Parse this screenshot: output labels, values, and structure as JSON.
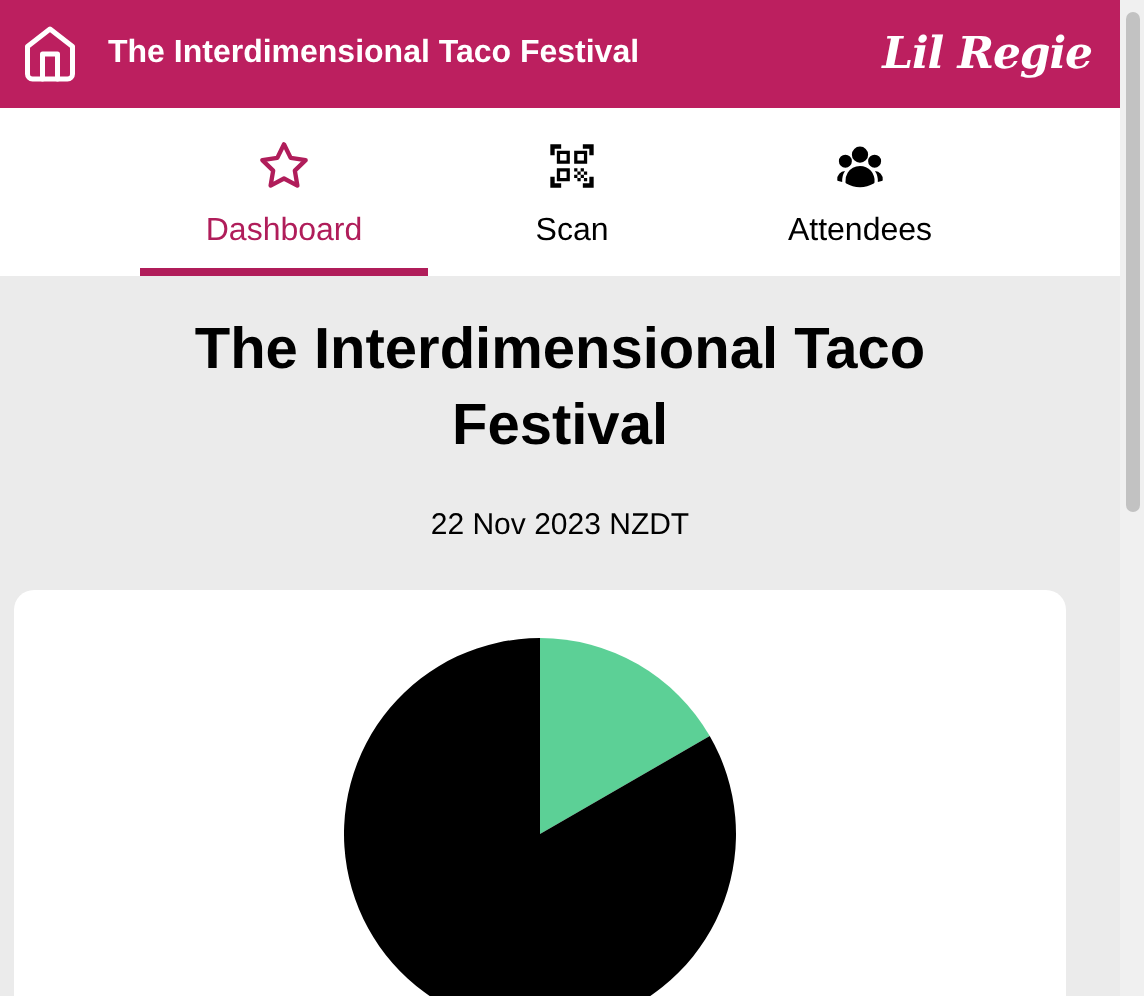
{
  "header": {
    "title": "The Interdimensional Taco Festival",
    "logo": "Lil Regie"
  },
  "tabs": [
    {
      "label": "Dashboard",
      "kind": "star",
      "selected": true
    },
    {
      "label": "Scan",
      "kind": "qr",
      "selected": false
    },
    {
      "label": "Attendees",
      "kind": "people",
      "selected": false
    }
  ],
  "event": {
    "title": "The Interdimensional Taco Festival",
    "date": "22 Nov 2023 NZDT"
  },
  "card": {
    "kind": "pie"
  }
}
